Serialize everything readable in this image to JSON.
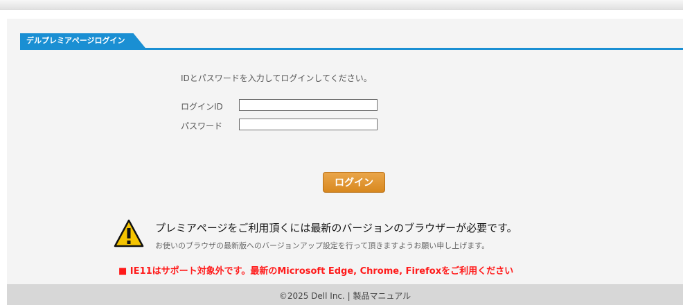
{
  "header": {
    "tab_title": "デルプレミアページログイン"
  },
  "login": {
    "instruction": "IDとパスワードを入力してログインしてください。",
    "id_label": "ログインID",
    "id_value": "",
    "password_label": "パスワード",
    "password_value": "",
    "button_label": "ログイン"
  },
  "notice": {
    "title": "プレミアページをご利用頂くには最新のバージョンのブラウザーが必要です。",
    "subtitle": "お使いのブラウザの最新版へのバージョンアップ設定を行って頂きますようお願い申し上げます。",
    "ie11_warning": "■ IE11はサポート対象外です。最新のMicrosoft Edge, Chrome, Firefoxをご利用ください",
    "icon": "warning-triangle-icon"
  },
  "footer": {
    "copyright": "©2025 Dell Inc. | ",
    "manual_link": "製品マニュアル"
  },
  "colors": {
    "accent_blue": "#1a8fd3",
    "button_orange": "#e09a38",
    "warning_red": "#ff1a1a",
    "warning_yellow": "#f5c400"
  }
}
